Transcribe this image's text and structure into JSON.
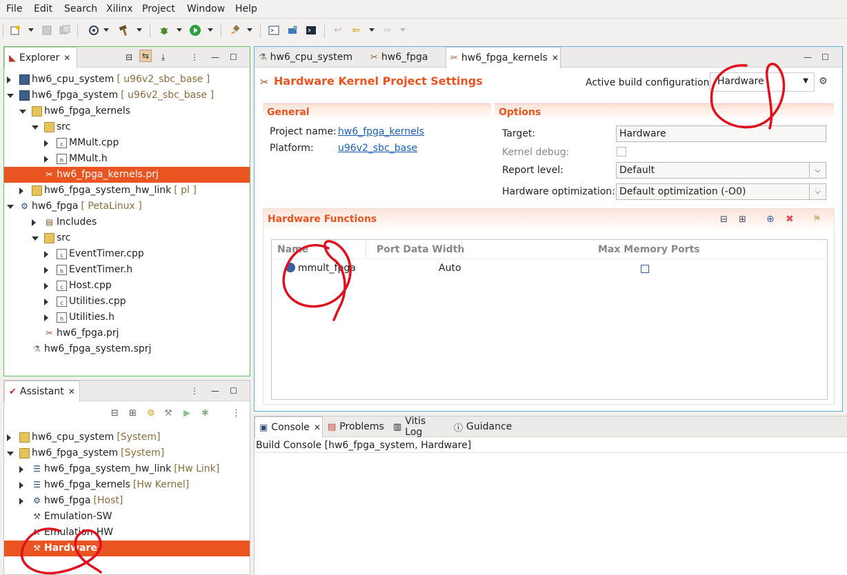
{
  "menu": [
    "File",
    "Edit",
    "Search",
    "Xilinx",
    "Project",
    "Window",
    "Help"
  ],
  "explorer": {
    "tab_label": "Explorer",
    "items": [
      {
        "label": "hw6_cpu_system",
        "decor": "[ u96v2_sbc_base ]"
      },
      {
        "label": "hw6_fpga_system",
        "decor": "[ u96v2_sbc_base ]"
      },
      {
        "label": "hw6_fpga_kernels",
        "decor": ""
      },
      {
        "label": "src",
        "decor": ""
      },
      {
        "label": "MMult.cpp",
        "decor": ""
      },
      {
        "label": "MMult.h",
        "decor": ""
      },
      {
        "label": "hw6_fpga_kernels.prj",
        "decor": ""
      },
      {
        "label": "hw6_fpga_system_hw_link",
        "decor": "[ pl ]"
      },
      {
        "label": "hw6_fpga",
        "decor": "[ PetaLinux ]"
      },
      {
        "label": "Includes",
        "decor": ""
      },
      {
        "label": "src",
        "decor": ""
      },
      {
        "label": "EventTimer.cpp",
        "decor": ""
      },
      {
        "label": "EventTimer.h",
        "decor": ""
      },
      {
        "label": "Host.cpp",
        "decor": ""
      },
      {
        "label": "Utilities.cpp",
        "decor": ""
      },
      {
        "label": "Utilities.h",
        "decor": ""
      },
      {
        "label": "hw6_fpga.prj",
        "decor": ""
      },
      {
        "label": "hw6_fpga_system.sprj",
        "decor": ""
      }
    ]
  },
  "assistant": {
    "tab_label": "Assistant",
    "items": [
      {
        "label": "hw6_cpu_system",
        "decor": "[System]"
      },
      {
        "label": "hw6_fpga_system",
        "decor": "[System]"
      },
      {
        "label": "hw6_fpga_system_hw_link",
        "decor": "[Hw Link]"
      },
      {
        "label": "hw6_fpga_kernels",
        "decor": "[Hw Kernel]"
      },
      {
        "label": "hw6_fpga",
        "decor": "[Host]"
      },
      {
        "label": "Emulation-SW",
        "decor": ""
      },
      {
        "label": "Emulation-HW",
        "decor": ""
      },
      {
        "label": "Hardware",
        "decor": ""
      }
    ]
  },
  "editor": {
    "tabs": [
      {
        "label": "hw6_cpu_system"
      },
      {
        "label": "hw6_fpga"
      },
      {
        "label": "hw6_fpga_kernels"
      }
    ],
    "title": "Hardware Kernel Project Settings",
    "active_build_label": "Active build configuration:",
    "active_build_value": "Hardware",
    "general": {
      "header": "General",
      "project_name_label": "Project name:",
      "project_name_value": "hw6_fpga_kernels",
      "platform_label": "Platform:",
      "platform_value": "u96v2_sbc_base"
    },
    "options": {
      "header": "Options",
      "target_label": "Target:",
      "target_value": "Hardware",
      "kernel_debug_label": "Kernel debug:",
      "report_level_label": "Report level:",
      "report_level_value": "Default",
      "hw_opt_label": "Hardware optimization:",
      "hw_opt_value": "Default optimization (-O0)"
    },
    "hw_functions": {
      "header": "Hardware Functions",
      "columns": [
        "Name",
        "Port Data Width",
        "Max Memory Ports"
      ],
      "rows": [
        {
          "name": "mmult_fpga",
          "port_width": "Auto"
        }
      ]
    }
  },
  "console": {
    "tabs": [
      "Console",
      "Problems",
      "Vitis Log",
      "Guidance"
    ],
    "build_console": "Build Console [hw6_fpga_system, Hardware]"
  },
  "colors": {
    "accent": "#e95420",
    "annotation": "#e0101f",
    "focus_border": "#5fc45f"
  }
}
